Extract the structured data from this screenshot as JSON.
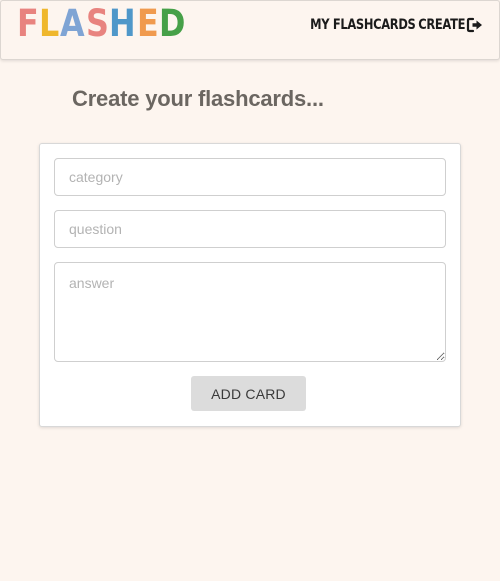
{
  "header": {
    "logo": {
      "letters": [
        {
          "char": "F",
          "color": "#e8837f"
        },
        {
          "char": "L",
          "color": "#efb72d"
        },
        {
          "char": "A",
          "color": "#7fa4d4"
        },
        {
          "char": "S",
          "color": "#e8837f"
        },
        {
          "char": "H",
          "color": "#4f97c9"
        },
        {
          "char": "E",
          "color": "#f09a4e"
        },
        {
          "char": "D",
          "color": "#46a048"
        }
      ]
    },
    "nav": {
      "my_flashcards": "MY FLASHCARDS",
      "create": "CREATE",
      "logout_icon": "sign-out-icon"
    }
  },
  "main": {
    "title": "Create your flashcards...",
    "form": {
      "category_placeholder": "category",
      "category_value": "",
      "question_placeholder": "question",
      "question_value": "",
      "answer_placeholder": "answer",
      "answer_value": "",
      "submit_label": "ADD CARD"
    }
  }
}
